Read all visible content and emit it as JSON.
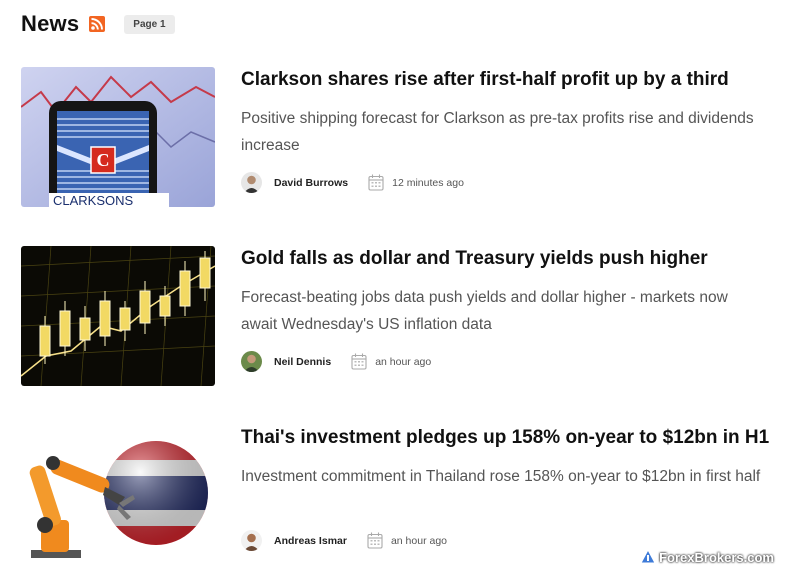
{
  "header": {
    "title": "News",
    "page_badge": "Page 1"
  },
  "articles": [
    {
      "headline": "Clarkson shares rise after first-half profit up by a third",
      "summary": "Positive shipping forecast for Clarkson as pre-tax profits rise and dividends increase",
      "author": "David Burrows",
      "time": "12 minutes ago",
      "thumb_text": "CLARKSONS"
    },
    {
      "headline": "Gold falls as dollar and Treasury yields push higher",
      "summary": "Forecast-beating jobs data push yields and dollar higher - markets now await Wednesday's US inflation data",
      "author": "Neil Dennis",
      "time": "an hour ago"
    },
    {
      "headline": "Thai's investment pledges up 158% on-year to $12bn in H1",
      "summary": "Investment commitment in Thailand rose 158% on-year to $12bn in first half",
      "author": "Andreas Ismar",
      "time": "an hour ago"
    }
  ],
  "watermark": "ForexBrokers.com",
  "icons": [
    "rss-icon",
    "calendar-icon",
    "avatar"
  ]
}
